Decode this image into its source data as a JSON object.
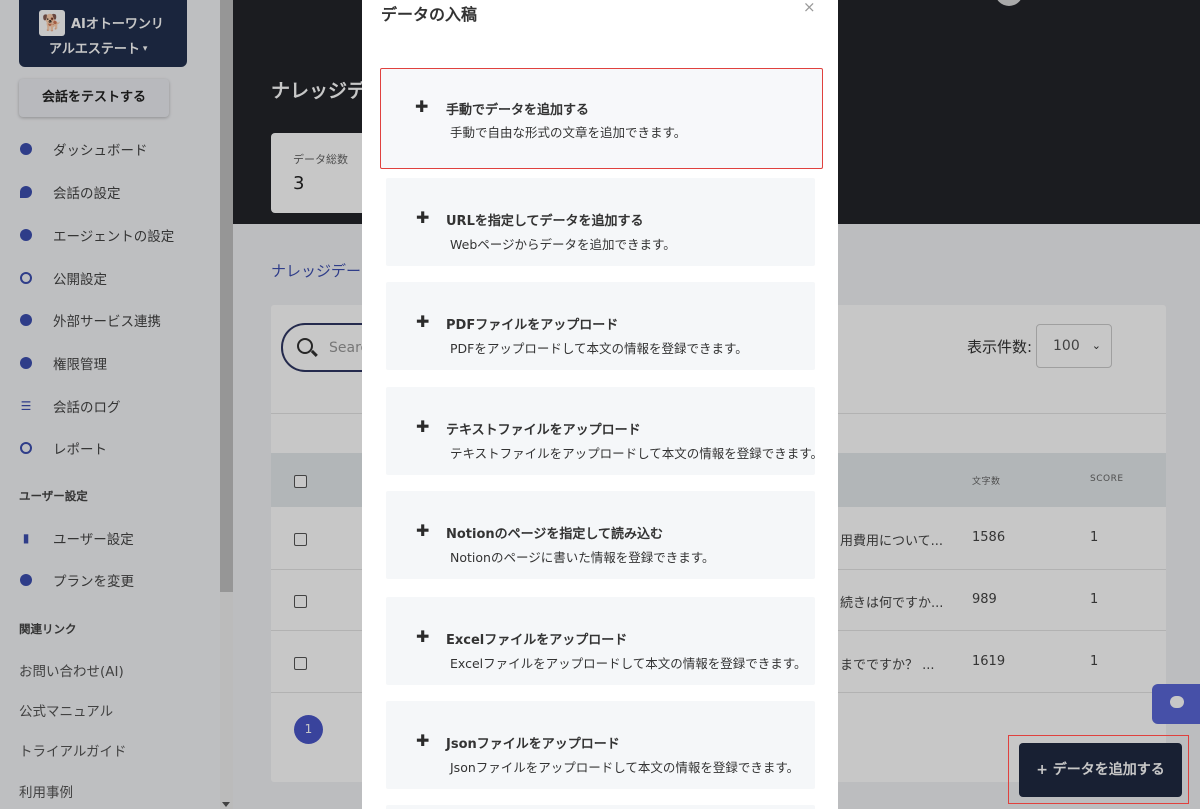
{
  "brand": {
    "name_line1": "AIオトーワンリ",
    "name_line2": "アルエステート",
    "caret": "▾"
  },
  "sidebar": {
    "test_button": "会話をテストする",
    "items": [
      {
        "label": "ダッシュボード",
        "icon": "pie-chart-icon"
      },
      {
        "label": "会話の設定",
        "icon": "chat-bubble-icon"
      },
      {
        "label": "エージェントの設定",
        "icon": "smiley-icon"
      },
      {
        "label": "公開設定",
        "icon": "globe-icon"
      },
      {
        "label": "外部サービス連携",
        "icon": "plug-icon"
      },
      {
        "label": "権限管理",
        "icon": "user-circle-icon"
      },
      {
        "label": "会話のログ",
        "icon": "list-icon"
      },
      {
        "label": "レポート",
        "icon": "compass-icon"
      }
    ],
    "user_section_title": "ユーザー設定",
    "user_items": [
      {
        "label": "ユーザー設定",
        "icon": "bar-chart-icon"
      },
      {
        "label": "プランを変更",
        "icon": "rocket-icon"
      }
    ],
    "links_section_title": "関連リンク",
    "links": [
      "お問い合わせ(AI)",
      "公式マニュアル",
      "トライアルガイド",
      "利用事例"
    ]
  },
  "main": {
    "title": "ナレッジデ",
    "stat_label": "データ総数",
    "stat_value": "3",
    "breadcrumb": "ナレッジデー",
    "search_placeholder": "Searc",
    "per_page_label": "表示件数:",
    "per_page_value": "100",
    "columns": {
      "chars": "文字数",
      "score": "SCORE"
    },
    "rows": [
      {
        "snippet": "用費用について...",
        "chars": "1586",
        "score": "1"
      },
      {
        "snippet": "続きは何ですか...",
        "chars": "989",
        "score": "1"
      },
      {
        "snippet": "までですか？ ...",
        "chars": "1619",
        "score": "1"
      }
    ],
    "page": "1",
    "add_data_button": "+ データを追加する"
  },
  "modal": {
    "title": "データの入稿",
    "close": "×",
    "options": [
      {
        "title": "手動でデータを追加する",
        "desc": "手動で自由な形式の文章を追加できます。"
      },
      {
        "title": "URLを指定してデータを追加する",
        "desc": "Webページからデータを追加できます。"
      },
      {
        "title": "PDFファイルをアップロード",
        "desc": "PDFをアップロードして本文の情報を登録できます。"
      },
      {
        "title": "テキストファイルをアップロード",
        "desc": "テキストファイルをアップロードして本文の情報を登録できます。"
      },
      {
        "title": "Notionのページを指定して読み込む",
        "desc": "Notionのページに書いた情報を登録できます。"
      },
      {
        "title": "Excelファイルをアップロード",
        "desc": "Excelファイルをアップロードして本文の情報を登録できます。"
      },
      {
        "title": "Jsonファイルをアップロード",
        "desc": "Jsonファイルをアップロードして本文の情報を登録できます。"
      }
    ]
  }
}
